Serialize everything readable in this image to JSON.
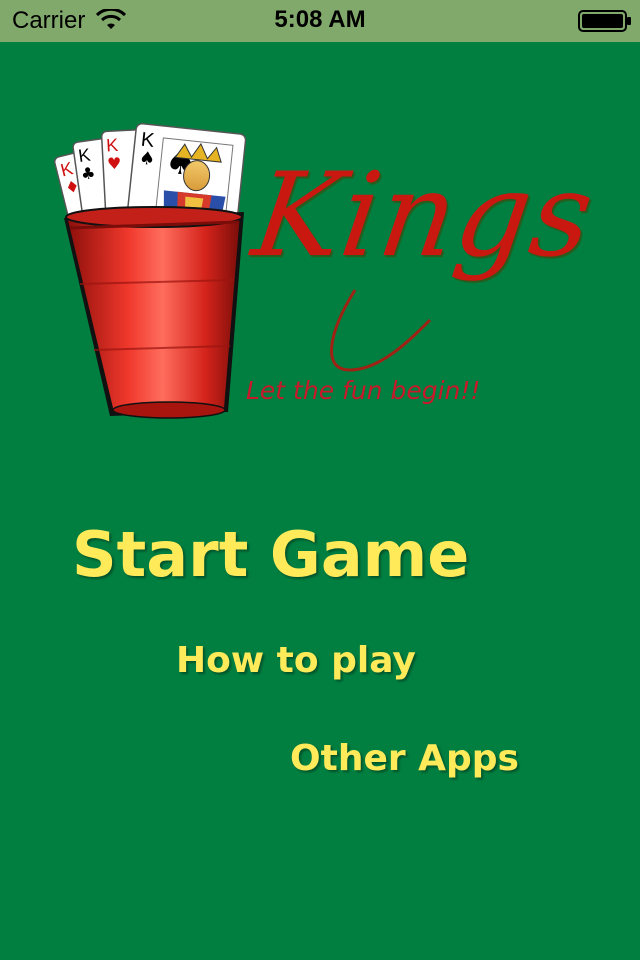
{
  "status_bar": {
    "carrier": "Carrier",
    "time": "5:08 AM",
    "wifi_icon": "wifi-icon",
    "battery_icon": "battery-icon"
  },
  "logo": {
    "title": "Kings",
    "tagline": "Let the fun begin!!",
    "card_ranks": [
      "K",
      "K",
      "K",
      "K"
    ],
    "card_suits": [
      "♦",
      "♣",
      "♥",
      "♠"
    ],
    "colors": {
      "title": "#c81810",
      "tagline": "#c8182a",
      "cup": "#e3261f"
    }
  },
  "menu": {
    "start_game": "Start Game",
    "how_to_play": "How to play",
    "other_apps": "Other Apps"
  },
  "colors": {
    "background": "#007f40",
    "status_bar": "#81a96b",
    "menu_text": "#ffea5a"
  }
}
